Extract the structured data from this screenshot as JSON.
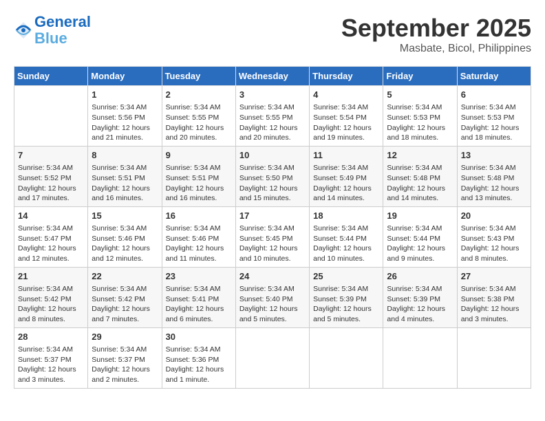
{
  "header": {
    "logo_line1": "General",
    "logo_line2": "Blue",
    "month": "September 2025",
    "location": "Masbate, Bicol, Philippines"
  },
  "days_of_week": [
    "Sunday",
    "Monday",
    "Tuesday",
    "Wednesday",
    "Thursday",
    "Friday",
    "Saturday"
  ],
  "weeks": [
    [
      {
        "day": "",
        "info": ""
      },
      {
        "day": "1",
        "info": "Sunrise: 5:34 AM\nSunset: 5:56 PM\nDaylight: 12 hours\nand 21 minutes."
      },
      {
        "day": "2",
        "info": "Sunrise: 5:34 AM\nSunset: 5:55 PM\nDaylight: 12 hours\nand 20 minutes."
      },
      {
        "day": "3",
        "info": "Sunrise: 5:34 AM\nSunset: 5:55 PM\nDaylight: 12 hours\nand 20 minutes."
      },
      {
        "day": "4",
        "info": "Sunrise: 5:34 AM\nSunset: 5:54 PM\nDaylight: 12 hours\nand 19 minutes."
      },
      {
        "day": "5",
        "info": "Sunrise: 5:34 AM\nSunset: 5:53 PM\nDaylight: 12 hours\nand 18 minutes."
      },
      {
        "day": "6",
        "info": "Sunrise: 5:34 AM\nSunset: 5:53 PM\nDaylight: 12 hours\nand 18 minutes."
      }
    ],
    [
      {
        "day": "7",
        "info": "Sunrise: 5:34 AM\nSunset: 5:52 PM\nDaylight: 12 hours\nand 17 minutes."
      },
      {
        "day": "8",
        "info": "Sunrise: 5:34 AM\nSunset: 5:51 PM\nDaylight: 12 hours\nand 16 minutes."
      },
      {
        "day": "9",
        "info": "Sunrise: 5:34 AM\nSunset: 5:51 PM\nDaylight: 12 hours\nand 16 minutes."
      },
      {
        "day": "10",
        "info": "Sunrise: 5:34 AM\nSunset: 5:50 PM\nDaylight: 12 hours\nand 15 minutes."
      },
      {
        "day": "11",
        "info": "Sunrise: 5:34 AM\nSunset: 5:49 PM\nDaylight: 12 hours\nand 14 minutes."
      },
      {
        "day": "12",
        "info": "Sunrise: 5:34 AM\nSunset: 5:48 PM\nDaylight: 12 hours\nand 14 minutes."
      },
      {
        "day": "13",
        "info": "Sunrise: 5:34 AM\nSunset: 5:48 PM\nDaylight: 12 hours\nand 13 minutes."
      }
    ],
    [
      {
        "day": "14",
        "info": "Sunrise: 5:34 AM\nSunset: 5:47 PM\nDaylight: 12 hours\nand 12 minutes."
      },
      {
        "day": "15",
        "info": "Sunrise: 5:34 AM\nSunset: 5:46 PM\nDaylight: 12 hours\nand 12 minutes."
      },
      {
        "day": "16",
        "info": "Sunrise: 5:34 AM\nSunset: 5:46 PM\nDaylight: 12 hours\nand 11 minutes."
      },
      {
        "day": "17",
        "info": "Sunrise: 5:34 AM\nSunset: 5:45 PM\nDaylight: 12 hours\nand 10 minutes."
      },
      {
        "day": "18",
        "info": "Sunrise: 5:34 AM\nSunset: 5:44 PM\nDaylight: 12 hours\nand 10 minutes."
      },
      {
        "day": "19",
        "info": "Sunrise: 5:34 AM\nSunset: 5:44 PM\nDaylight: 12 hours\nand 9 minutes."
      },
      {
        "day": "20",
        "info": "Sunrise: 5:34 AM\nSunset: 5:43 PM\nDaylight: 12 hours\nand 8 minutes."
      }
    ],
    [
      {
        "day": "21",
        "info": "Sunrise: 5:34 AM\nSunset: 5:42 PM\nDaylight: 12 hours\nand 8 minutes."
      },
      {
        "day": "22",
        "info": "Sunrise: 5:34 AM\nSunset: 5:42 PM\nDaylight: 12 hours\nand 7 minutes."
      },
      {
        "day": "23",
        "info": "Sunrise: 5:34 AM\nSunset: 5:41 PM\nDaylight: 12 hours\nand 6 minutes."
      },
      {
        "day": "24",
        "info": "Sunrise: 5:34 AM\nSunset: 5:40 PM\nDaylight: 12 hours\nand 5 minutes."
      },
      {
        "day": "25",
        "info": "Sunrise: 5:34 AM\nSunset: 5:39 PM\nDaylight: 12 hours\nand 5 minutes."
      },
      {
        "day": "26",
        "info": "Sunrise: 5:34 AM\nSunset: 5:39 PM\nDaylight: 12 hours\nand 4 minutes."
      },
      {
        "day": "27",
        "info": "Sunrise: 5:34 AM\nSunset: 5:38 PM\nDaylight: 12 hours\nand 3 minutes."
      }
    ],
    [
      {
        "day": "28",
        "info": "Sunrise: 5:34 AM\nSunset: 5:37 PM\nDaylight: 12 hours\nand 3 minutes."
      },
      {
        "day": "29",
        "info": "Sunrise: 5:34 AM\nSunset: 5:37 PM\nDaylight: 12 hours\nand 2 minutes."
      },
      {
        "day": "30",
        "info": "Sunrise: 5:34 AM\nSunset: 5:36 PM\nDaylight: 12 hours\nand 1 minute."
      },
      {
        "day": "",
        "info": ""
      },
      {
        "day": "",
        "info": ""
      },
      {
        "day": "",
        "info": ""
      },
      {
        "day": "",
        "info": ""
      }
    ]
  ]
}
